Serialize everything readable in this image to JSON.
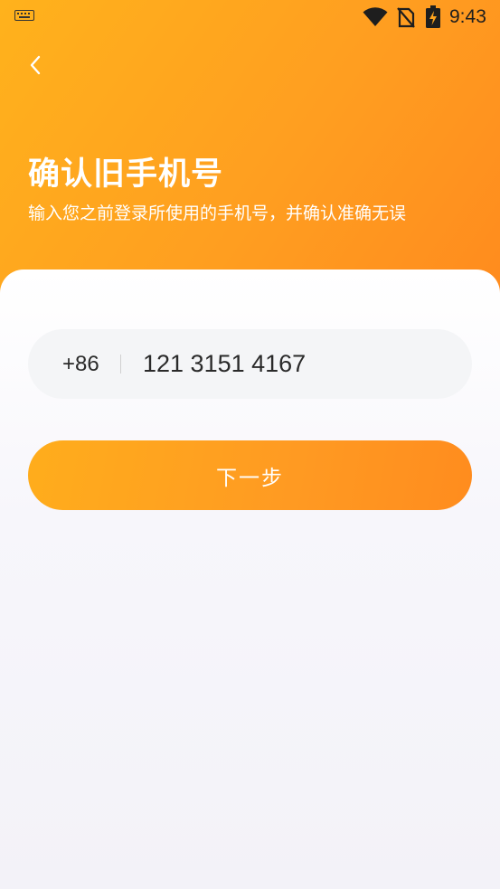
{
  "status_bar": {
    "time": "9:43",
    "icons": [
      "keyboard-icon",
      "wifi-icon",
      "no-sim-icon",
      "battery-charging-icon"
    ]
  },
  "nav": {
    "back_icon": "chevron-left-icon"
  },
  "header": {
    "title": "确认旧手机号",
    "subtitle": "输入您之前登录所使用的手机号，并确认准确无误"
  },
  "form": {
    "country_code": "+86",
    "phone_value": "121 3151 4167",
    "next_label": "下一步"
  },
  "colors": {
    "accent_start": "#ffb21c",
    "accent_end": "#ff8a1e",
    "input_bg": "#f4f5f7",
    "card_bg": "#f6f5fb"
  }
}
